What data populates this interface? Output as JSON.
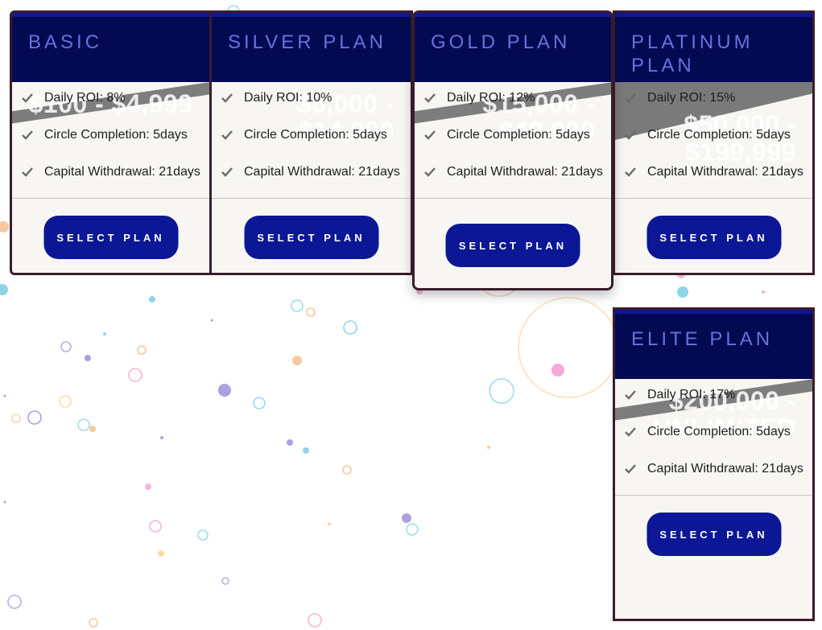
{
  "plans": [
    {
      "title": "BASIC",
      "price": "$100 - $4,999",
      "features": [
        "Daily ROI: 8%",
        "Circle Completion: 5days",
        "Capital Withdrawal: 21days"
      ],
      "button": "SELECT PLAN"
    },
    {
      "title": "SILVER PLAN",
      "price": "$5,000 - $14,999",
      "features": [
        "Daily ROI: 10%",
        "Circle Completion: 5days",
        "Capital Withdrawal: 21days"
      ],
      "button": "SELECT PLAN"
    },
    {
      "title": "GOLD PLAN",
      "price": "$15,000 - $49,999",
      "features": [
        "Daily ROI: 12%",
        "Circle Completion: 5days",
        "Capital Withdrawal: 21days"
      ],
      "button": "SELECT PLAN"
    },
    {
      "title": "PLATINUM PLAN",
      "price": "$50,000 - $199,999",
      "features": [
        "Daily ROI: 15%",
        "Circle Completion: 5days",
        "Capital Withdrawal: 21days"
      ],
      "button": "SELECT PLAN"
    },
    {
      "title": "ELITE PLAN",
      "price": "$200,000 - UNLIMITED",
      "features": [
        "Daily ROI: 17%",
        "Circle Completion: 5days",
        "Capital Withdrawal: 21days"
      ],
      "button": "SELECT PLAN"
    }
  ],
  "colors": {
    "header": "#030a52",
    "header_accent": "#0d1796",
    "title": "#6b70da",
    "button": "#0b1794",
    "card_bg": "#f8f6f3",
    "border": "#3b1c2c"
  },
  "icons": {
    "feature_bullet": "check-icon"
  }
}
